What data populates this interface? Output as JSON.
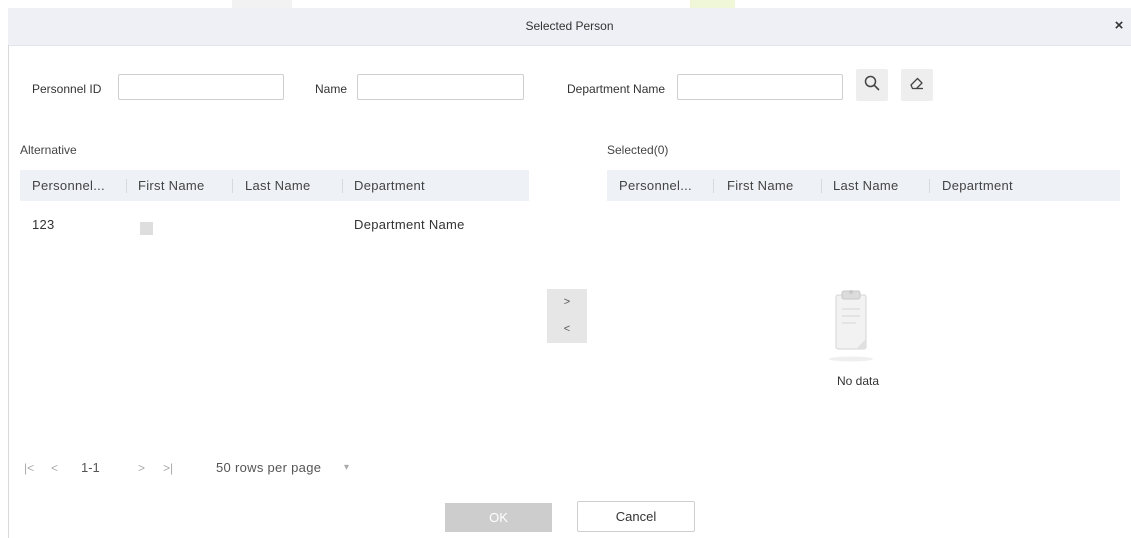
{
  "dialog": {
    "title": "Selected Person",
    "close_symbol": "×"
  },
  "filters": {
    "personnel_id_label": "Personnel ID",
    "personnel_id_value": "",
    "name_label": "Name",
    "name_value": "",
    "department_label": "Department Name",
    "department_value": ""
  },
  "icons": {
    "search": "search-icon",
    "clear": "eraser-icon",
    "clipboard": "clipboard-icon"
  },
  "alternative": {
    "label": "Alternative",
    "columns": [
      "Personnel...",
      "First Name",
      "Last Name",
      "Department"
    ],
    "rows": [
      {
        "personnel_id": "123",
        "first_name": "",
        "last_name": "",
        "department": "Department Name"
      }
    ]
  },
  "selected": {
    "label": "Selected(0)",
    "columns": [
      "Personnel...",
      "First Name",
      "Last Name",
      "Department"
    ],
    "empty_text": "No data"
  },
  "transfer": {
    "add_label": ">",
    "remove_label": "<"
  },
  "pager": {
    "first": "|<",
    "prev": "<",
    "range": "1-1",
    "next": ">",
    "last": ">|",
    "rows_per_page": "50 rows per page",
    "dropdown_arrow": "▾"
  },
  "actions": {
    "ok_label": "OK",
    "cancel_label": "Cancel"
  },
  "colors": {
    "header_bg": "#eef1f6",
    "title_bg": "#eef0f6",
    "ok_disabled_bg": "#cdcdcd"
  }
}
